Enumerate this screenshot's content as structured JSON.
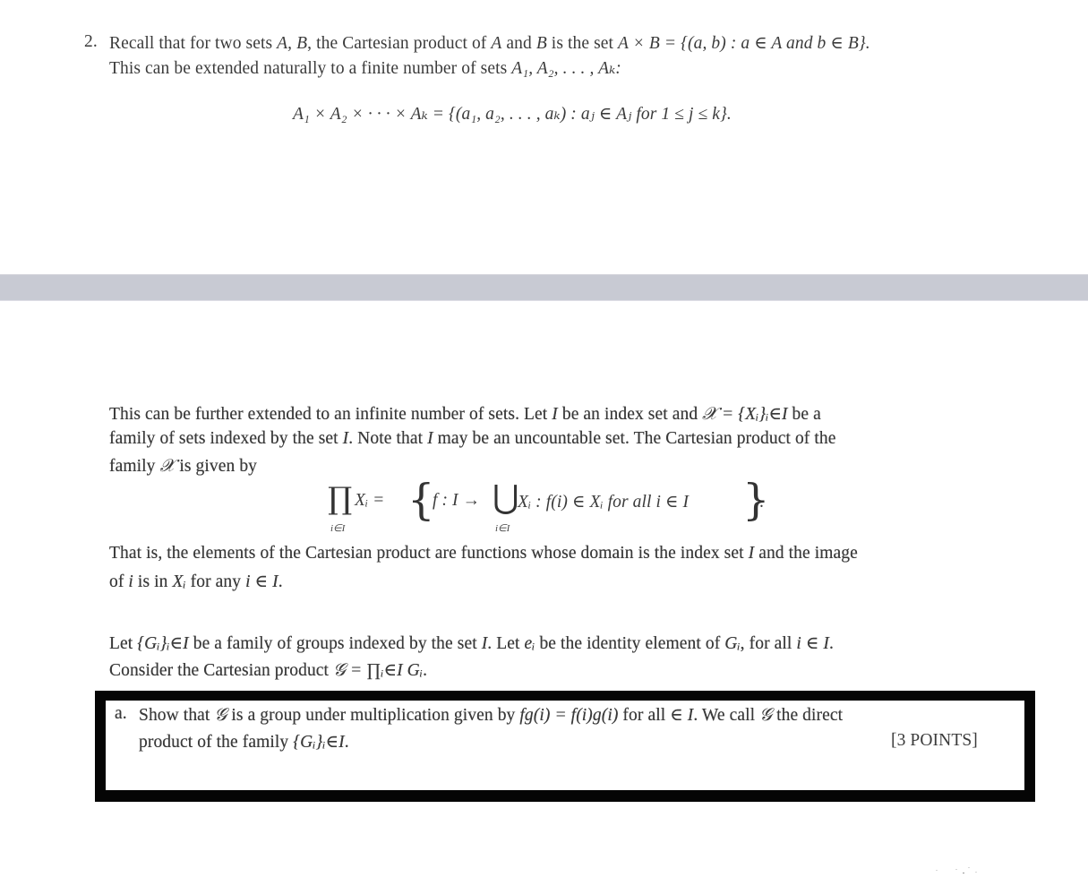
{
  "document": {
    "problem_number": "2.",
    "intro": {
      "line1_a": "Recall that for two sets ",
      "line1_vars": "A, B",
      "line1_b": ", the Cartesian product of ",
      "line1_A": "A",
      "line1_c": " and ",
      "line1_B": "B",
      "line1_d": " is the set ",
      "line1_formula": "A × B = {(a, b) : a ∈ A and b ∈ B}.",
      "line2_a": "This can be extended naturally to a finite number of sets ",
      "line2_vars": "A₁, A₂, . . . , Aₖ:"
    },
    "display_formula_1": "A₁ × A₂ × · · · × Aₖ = {(a₁, a₂, . . . , aₖ) : aⱼ ∈ Aⱼ  for 1 ≤ j ≤ k}.",
    "infinite": {
      "line1_a": "This can be further extended to an infinite number of sets. Let ",
      "line1_I": "I",
      "line1_b": " be an index set and ",
      "line1_formula": "𝒳 = {Xᵢ}ᵢ∈I",
      "line1_c": " be a",
      "line2_a": "family of sets indexed by the set ",
      "line2_I": "I",
      "line2_b": ". Note that ",
      "line2_I2": "I",
      "line2_c": " may be an uncountable set. The Cartesian product of the",
      "line3_a": "family ",
      "line3_X": "𝒳",
      "line3_b": " is given by"
    },
    "display_formula_2": {
      "prod": "∏",
      "prod_sub": "i∈I",
      "lhs": "Xᵢ =",
      "open_brace": "{",
      "f_map": "f : I →",
      "union": "⋃",
      "union_sub": "i∈I",
      "rhs": "Xᵢ : f(i) ∈ Xᵢ  for all  i ∈ I",
      "close_brace": "}",
      "period": "."
    },
    "that_is": {
      "line1_a": "That is, the elements of the Cartesian product are functions whose domain is the index set ",
      "line1_I": "I",
      "line1_b": " and the image",
      "line2_a": "of ",
      "line2_i": "i",
      "line2_b": " is in ",
      "line2_X": "Xᵢ",
      "line2_c": " for any ",
      "line2_formula": "i ∈ I",
      "line2_d": "."
    },
    "groups": {
      "line1_a": "Let ",
      "line1_G": "{Gᵢ}ᵢ∈I",
      "line1_b": " be a family of groups indexed by the set ",
      "line1_I": "I",
      "line1_c": ". Let ",
      "line1_e": "eᵢ",
      "line1_d": " be the identity element of ",
      "line1_Gi": "Gᵢ",
      "line1_e2": ", for all ",
      "line1_formula": "i ∈ I",
      "line1_f": ".",
      "line2_a": "Consider the Cartesian product ",
      "line2_formula": "𝒢 = ∏ᵢ∈I Gᵢ",
      "line2_b": "."
    },
    "part_a": {
      "label": "a.",
      "line1_a": "Show that ",
      "line1_G": "𝒢",
      "line1_b": " is a group under multiplication given by ",
      "line1_formula": "fg(i) = f(i)g(i)",
      "line1_c": " for all ",
      "line1_in": "∈ I",
      "line1_d": ". We call ",
      "line1_G2": "𝒢",
      "line1_e": " the direct",
      "line2_a": "product of the family ",
      "line2_formula": "{Gᵢ}ᵢ∈I",
      "line2_b": ".",
      "points": "[3 POINTS]"
    }
  },
  "colors": {
    "text": "#3a3a3a",
    "band": "#c8cad3",
    "box_border": "#050505",
    "background": "#ffffff"
  }
}
